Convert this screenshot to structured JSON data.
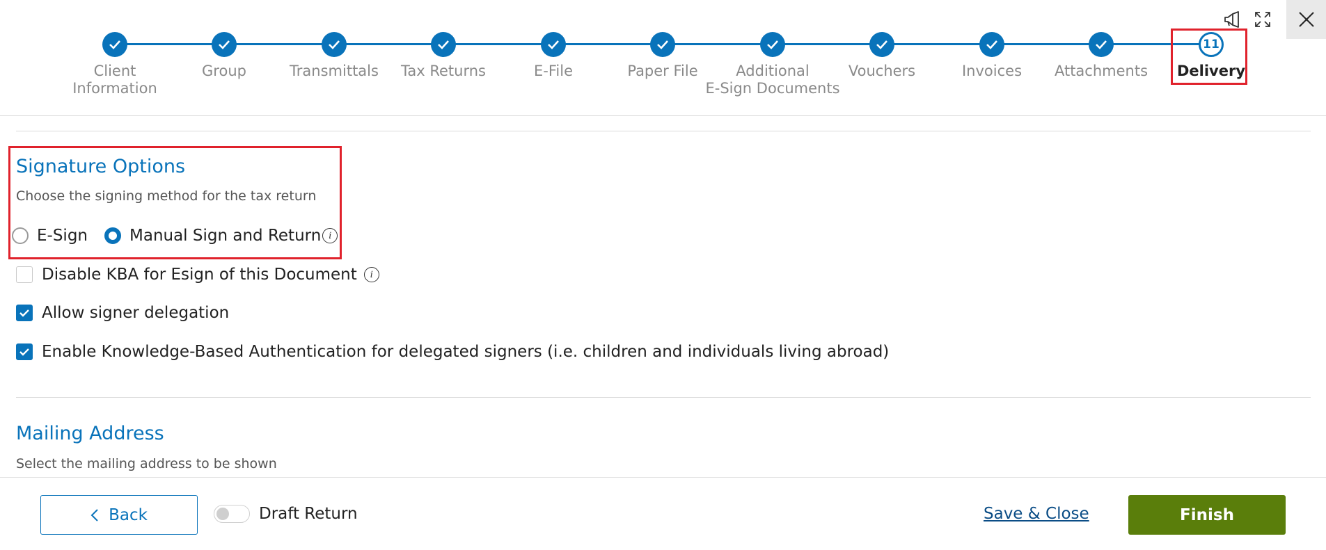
{
  "header": {
    "icons": {
      "announcement": "megaphone-icon",
      "fullscreen": "expand-icon",
      "close": "close-icon"
    }
  },
  "stepper": {
    "steps": [
      {
        "label1": "Client",
        "label2": "Information",
        "status": "complete"
      },
      {
        "label1": "Group",
        "label2": "",
        "status": "complete"
      },
      {
        "label1": "Transmittals",
        "label2": "",
        "status": "complete"
      },
      {
        "label1": "Tax Returns",
        "label2": "",
        "status": "complete"
      },
      {
        "label1": "E-File",
        "label2": "",
        "status": "complete"
      },
      {
        "label1": "Paper File",
        "label2": "",
        "status": "complete"
      },
      {
        "label1": "Additional",
        "label2": "E-Sign Documents",
        "status": "complete"
      },
      {
        "label1": "Vouchers",
        "label2": "",
        "status": "complete"
      },
      {
        "label1": "Invoices",
        "label2": "",
        "status": "complete"
      },
      {
        "label1": "Attachments",
        "label2": "",
        "status": "complete"
      },
      {
        "label1": "Delivery",
        "label2": "",
        "status": "current",
        "number": "11"
      }
    ]
  },
  "signature": {
    "title": "Signature Options",
    "subtitle": "Choose the signing method for the tax return",
    "options": [
      {
        "label": "E-Sign",
        "selected": false
      },
      {
        "label": "Manual Sign and Return",
        "selected": true
      }
    ],
    "checkboxes": [
      {
        "label": "Disable KBA for Esign of this Document",
        "checked": false
      },
      {
        "label": "Allow signer delegation",
        "checked": true
      },
      {
        "label": "Enable Knowledge-Based Authentication for delegated signers (i.e. children and individuals living abroad)",
        "checked": true
      }
    ]
  },
  "mailing": {
    "title": "Mailing Address",
    "subtitle": "Select the mailing address to be shown"
  },
  "footer": {
    "back_label": "Back",
    "draft_label": "Draft Return",
    "draft_on": false,
    "save_close_label": "Save & Close",
    "finish_label": "Finish"
  },
  "colors": {
    "accent": "#0973ba",
    "finish": "#5a7e0b",
    "highlight": "#e0222c"
  }
}
